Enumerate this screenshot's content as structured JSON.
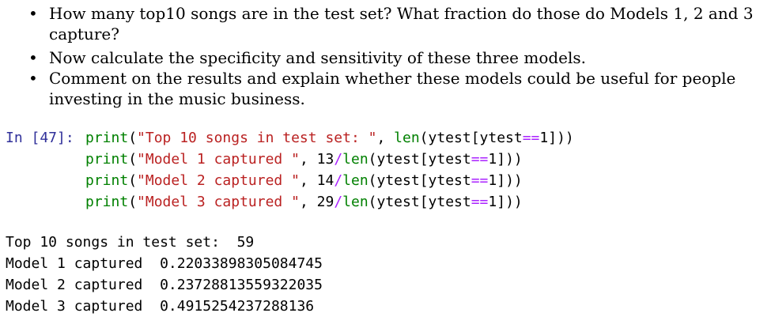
{
  "bullets": [
    "How many top10 songs are in the test set? What fraction do those do Models 1, 2 and 3 capture?",
    "Now calculate the specificity and sensitivity of these three models.",
    "Comment on the results and explain whether these models could be useful for people investing in the music business."
  ],
  "cell": {
    "prompt": "In [47]:",
    "lines": [
      {
        "func": "print",
        "open": "(",
        "string": "\"Top 10 songs in test set: \"",
        "sep": ", ",
        "call": "len",
        "args": "(ytest[ytest",
        "eq": "==",
        "num": "1",
        "close": "]))"
      },
      {
        "func": "print",
        "open": "(",
        "string": "\"Model 1 captured \"",
        "sep": ", ",
        "numer": "13",
        "div": "/",
        "call": "len",
        "args": "(ytest[ytest",
        "eq": "==",
        "num": "1",
        "close": "]))"
      },
      {
        "func": "print",
        "open": "(",
        "string": "\"Model 2 captured \"",
        "sep": ", ",
        "numer": "14",
        "div": "/",
        "call": "len",
        "args": "(ytest[ytest",
        "eq": "==",
        "num": "1",
        "close": "]))"
      },
      {
        "func": "print",
        "open": "(",
        "string": "\"Model 3 captured \"",
        "sep": ", ",
        "numer": "29",
        "div": "/",
        "call": "len",
        "args": "(ytest[ytest",
        "eq": "==",
        "num": "1",
        "close": "]))"
      }
    ]
  },
  "output": [
    "Top 10 songs in test set:  59",
    "Model 1 captured  0.22033898305084745",
    "Model 2 captured  0.23728813559322035",
    "Model 3 captured  0.4915254237288136"
  ],
  "colors": {
    "prompt": "#30309a",
    "keyword": "#008000",
    "string": "#ba2121",
    "operator": "#aa22ff"
  }
}
